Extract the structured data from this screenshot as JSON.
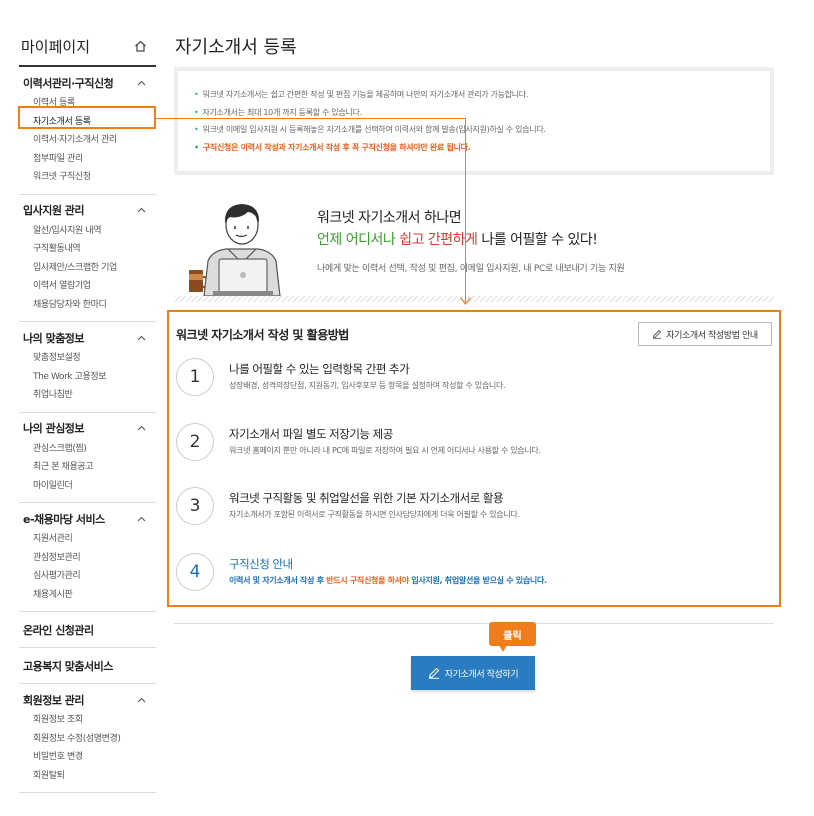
{
  "sidebar": {
    "title": "마이페이지",
    "sections": [
      {
        "title": "이력서관리·구직신청",
        "items": [
          "이력서 등록",
          "자기소개서 등록",
          "이력서·자기소개서 관리",
          "첨부파일 관리",
          "워크넷 구직신청"
        ]
      },
      {
        "title": "입사지원 관리",
        "items": [
          "알선/입사지원 내역",
          "구직활동내역",
          "입사제안/스크랩한 기업",
          "이력서 열람기업",
          "채용담당자와 한마디"
        ]
      },
      {
        "title": "나의 맞춤정보",
        "items": [
          "맞춤정보설정",
          "The Work 고용정보",
          "취업나침반"
        ]
      },
      {
        "title": "나의 관심정보",
        "items": [
          "관심스크랩(찜)",
          "최근 본 채용공고",
          "마이일린더"
        ]
      },
      {
        "title": "e-채용마당 서비스",
        "items": [
          "지원서관리",
          "관심정보관리",
          "심사평가관리",
          "채용게시판"
        ]
      },
      {
        "title": "온라인 신청관리"
      },
      {
        "title": "고용복지 맞춤서비스"
      },
      {
        "title": "회원정보 관리",
        "items": [
          "회원정보 조회",
          "회원정보 수정(성명변경)",
          "비밀번호 변경",
          "회원탈퇴"
        ]
      }
    ]
  },
  "page": {
    "title": "자기소개서 등록"
  },
  "notice": [
    "워크넷 자기소개서는 쉽고 간편한 작성 및 편집 기능을 제공하며 나만의 자기소개서 관리가 가능합니다.",
    "자기소개서는 최대 10개 까지 등록할 수 있습니다.",
    "워크넷 이메일 입사지원 시 등록해놓은 자기소개를 선택하여 이력서와 함께 발송(입사지원)하실 수 있습니다.",
    "구직신청은 이력서 작성과 자기소개서 작성 후 꼭 구직신청을 하셔야만 완료 됩니다."
  ],
  "hero": {
    "line1": "워크넷 자기소개서 하나면",
    "line2_a": "언제 어디서나",
    "line2_b": "쉽고 간편하게",
    "line2_c": "나를 어필할 수 있다!",
    "sub": "나에게 맞는 이력서 선택, 작성 및 편집, 이메일 입사지원, 내 PC로 내보내기 기능 지원"
  },
  "howto": {
    "title": "워크넷 자기소개서 작성 및 활용방법",
    "guide_button": "자기소개서 작성방법 안내",
    "steps": [
      {
        "num": "1",
        "title": "나를 어필할 수 있는 입력항목 간편 추가",
        "desc": "성장배경, 성격의장단점, 지원동기, 입사후포부 등 항목을 설정하여 작성할 수 있습니다."
      },
      {
        "num": "2",
        "title": "자기소개서 파일 별도 저장기능 제공",
        "desc": "워크넷 홈페이지 뿐만 아니라 내 PC에 파일로 저장하여 필요 시 언제 어디서나 사용할 수 있습니다."
      },
      {
        "num": "3",
        "title": "워크넷 구직활동 및 취업알선을 위한 기본 자기소개서로 활용",
        "desc": "자기소개서가 포함된 이력서로 구직활동을 하시면 인사담당자에게 더욱 어필할 수 있습니다."
      },
      {
        "num": "4",
        "title": "구직신청 안내",
        "desc_a": "이력서 및 자기소개서 작성 후",
        "desc_b": "반드시 구직신청을 하셔야",
        "desc_c": "입사지원, 취업알선을 받으실 수 있습니다."
      }
    ]
  },
  "cta": {
    "tooltip": "클릭",
    "button": "자기소개서 작성하기"
  },
  "colors": {
    "accent": "#f07d1b",
    "primary": "#2b7bc0",
    "green": "#3a9d2e",
    "warn": "#e65e1a"
  },
  "icons": {
    "home": "home-icon",
    "chevron": "chevron-up-icon",
    "pencil": "pencil-icon"
  }
}
